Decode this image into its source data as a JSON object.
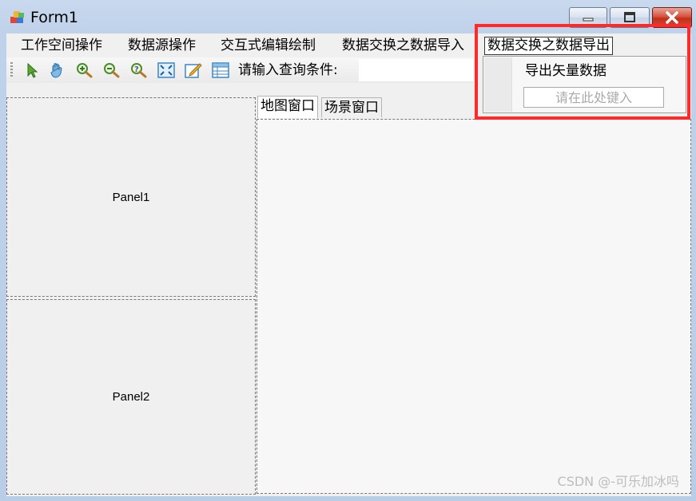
{
  "window": {
    "title": "Form1",
    "controls": {
      "minimize_icon": "minimize-icon",
      "maximize_icon": "maximize-icon",
      "close_icon": "close-icon"
    }
  },
  "menubar": {
    "items": [
      {
        "label": "工作空间操作"
      },
      {
        "label": "数据源操作"
      },
      {
        "label": "交互式编辑绘制"
      },
      {
        "label": "数据交换之数据导入"
      },
      {
        "label": "数据交换之数据导出",
        "active": true
      }
    ]
  },
  "toolbar": {
    "tools": [
      "select-arrow-icon",
      "pan-hand-icon",
      "zoom-in-icon",
      "zoom-out-icon",
      "identify-icon",
      "full-extent-icon",
      "edit-icon",
      "attribute-table-icon"
    ],
    "query_label": "请输入查询条件:",
    "query_value": ""
  },
  "dropdown": {
    "item": "导出矢量数据",
    "input_placeholder": "请在此处键入"
  },
  "panels": {
    "panel1": "Panel1",
    "panel2": "Panel2"
  },
  "tabs": [
    {
      "label": "地图窗口",
      "selected": true
    },
    {
      "label": "场景窗口"
    }
  ],
  "highlight_color": "#ff2a2a",
  "watermark": "CSDN @-可乐加冰吗"
}
